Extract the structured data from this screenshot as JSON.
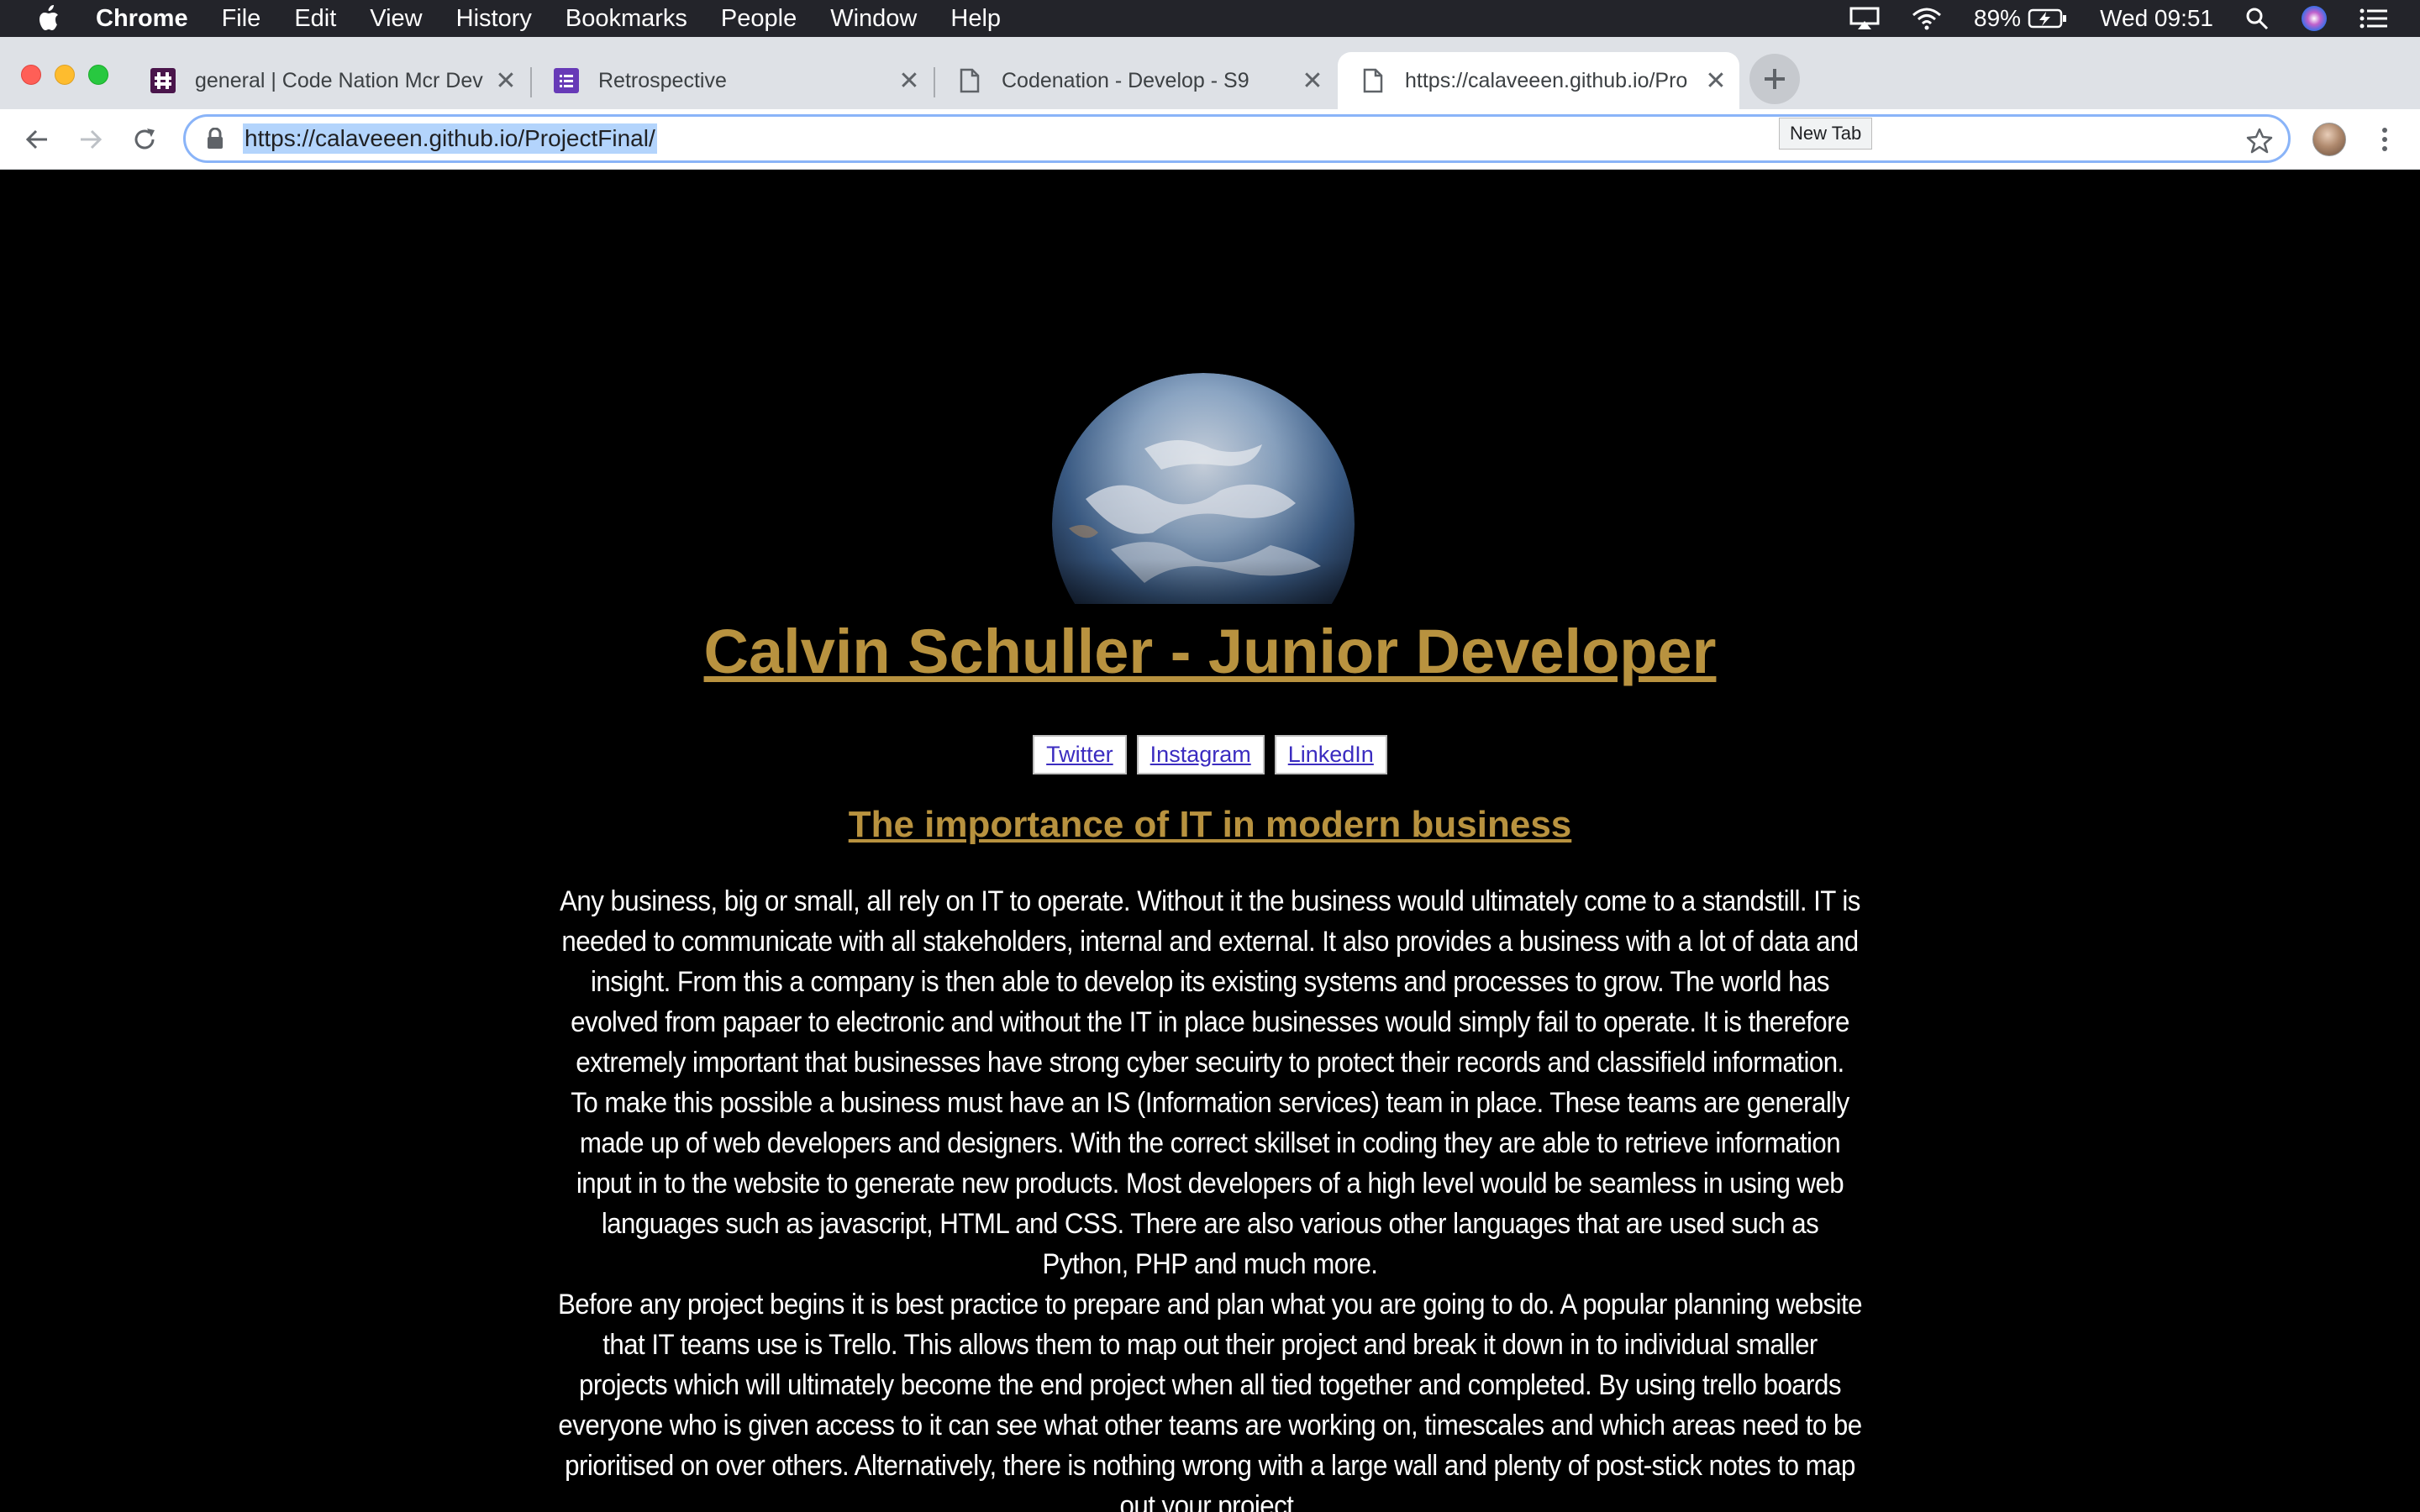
{
  "menubar": {
    "app_name": "Chrome",
    "items": [
      "File",
      "Edit",
      "View",
      "History",
      "Bookmarks",
      "People",
      "Window",
      "Help"
    ],
    "battery": "89%",
    "clock": "Wed 09:51"
  },
  "tabs": [
    {
      "title": "general | Code Nation Mcr Dev",
      "icon": "slack-icon"
    },
    {
      "title": "Retrospective",
      "icon": "form-icon"
    },
    {
      "title": "Codenation - Develop - S9",
      "icon": "document-icon"
    },
    {
      "title": "https://calaveeen.github.io/Pro",
      "icon": "document-icon",
      "active": true
    }
  ],
  "new_tab_tooltip": "New Tab",
  "toolbar": {
    "url": "https://calaveeen.github.io/ProjectFinal/"
  },
  "page": {
    "title": "Calvin Schuller - Junior Developer",
    "social": [
      "Twitter",
      "Instagram",
      "LinkedIn"
    ],
    "subtitle": "The importance of IT in modern business",
    "paragraphs": [
      "Any business, big or small, all rely on IT to operate. Without it the business would ultimately come to a standstill. IT is needed to communicate with all stakeholders, internal and external. It also provides a business with a lot of data and insight. From this a company is then able to develop its existing systems and processes to grow. The world has evolved from papaer to electronic and without the IT in place businesses would simply fail to operate. It is therefore extremely important that businesses have strong cyber secuirty to protect their records and classifield information.",
      "To make this possible a business must have an IS (Information services) team in place. These teams are generally made up of web developers and designers. With the correct skillset in coding they are able to retrieve information input in to the website to generate new products. Most developers of a high level would be seamless in using web languages such as javascript, HTML and CSS. There are also various other languages that are used such as Python, PHP and much more.",
      "Before any project begins it is best practice to prepare and plan what you are going to do. A popular planning website that IT teams use is Trello. This allows them to map out their project and break it down in to individual smaller projects which will ultimately become the end project when all tied together and completed. By using trello boards everyone who is given access to it can see what other teams are working on, timescales and which areas need to be prioritised on over others. Alternatively, there is nothing wrong with a large wall and plenty of post-stick notes to map out your project."
    ]
  },
  "colors": {
    "heading": "#b8923f",
    "page_bg": "#000000",
    "body_text": "#ffffff"
  }
}
